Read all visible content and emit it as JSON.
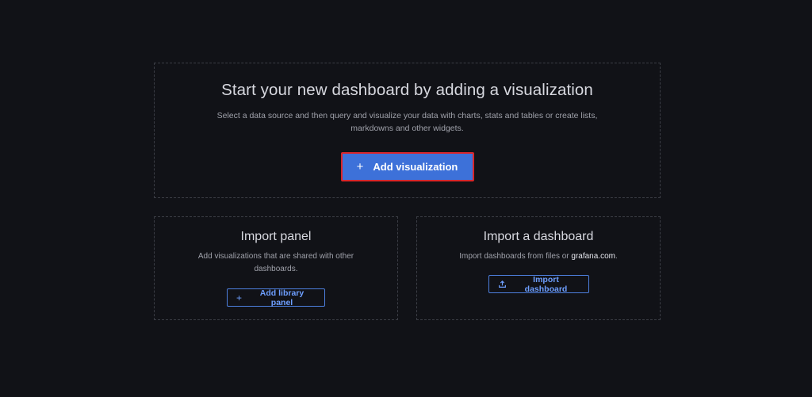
{
  "main": {
    "title": "Start your new dashboard by adding a visualization",
    "description": "Select a data source and then query and visualize your data with charts, stats and tables or create lists, markdowns and other widgets.",
    "add_button_label": "Add visualization",
    "add_button_icon": "plus-icon"
  },
  "import_panel": {
    "title": "Import panel",
    "description": "Add visualizations that are shared with other dashboards.",
    "button_label": "Add library panel",
    "button_icon": "plus-icon"
  },
  "import_dashboard": {
    "title": "Import a dashboard",
    "description_prefix": "Import dashboards from files or ",
    "description_link": "grafana.com",
    "description_suffix": ".",
    "button_label": "Import dashboard",
    "button_icon": "upload-icon"
  },
  "colors": {
    "background": "#111217",
    "primary": "#3d71d9",
    "highlight_border": "#d8262b",
    "link_blue": "#6e9fff"
  }
}
